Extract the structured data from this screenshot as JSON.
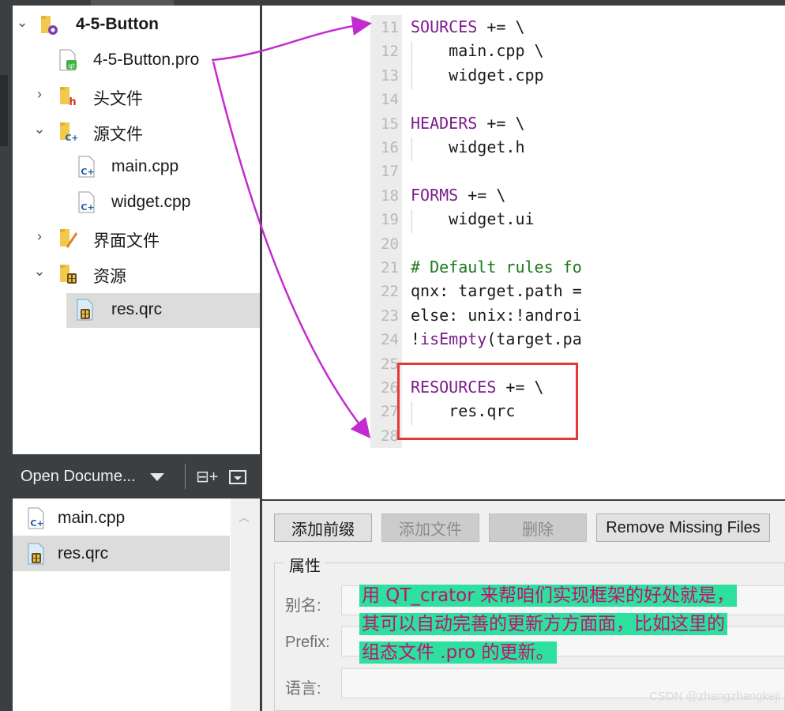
{
  "project_tree": {
    "root": {
      "label": "4-5-Button",
      "expanded": true
    },
    "items": [
      {
        "label": "4-5-Button.pro",
        "icon": "qt-project-file-icon"
      },
      {
        "label": "头文件",
        "icon": "header-folder-icon",
        "expanded": false
      },
      {
        "label": "源文件",
        "icon": "source-folder-icon",
        "expanded": true
      },
      {
        "label": "main.cpp",
        "icon": "cpp-file-icon"
      },
      {
        "label": "widget.cpp",
        "icon": "cpp-file-icon"
      },
      {
        "label": "界面文件",
        "icon": "forms-folder-icon",
        "expanded": false
      },
      {
        "label": "资源",
        "icon": "resources-folder-icon",
        "expanded": true
      },
      {
        "label": "res.qrc",
        "icon": "qrc-file-icon",
        "selected": true
      }
    ]
  },
  "open_documents": {
    "title": "Open Docume...",
    "items": [
      {
        "label": "main.cpp",
        "icon": "cpp-file-icon"
      },
      {
        "label": "res.qrc",
        "icon": "qrc-file-icon",
        "selected": true
      }
    ]
  },
  "editor": {
    "lines": [
      {
        "num": "11",
        "kw": "SOURCES",
        "rest": " += \\"
      },
      {
        "num": "12",
        "text": "    main.cpp \\"
      },
      {
        "num": "13",
        "text": "    widget.cpp"
      },
      {
        "num": "14",
        "text": ""
      },
      {
        "num": "15",
        "kw": "HEADERS",
        "rest": " += \\"
      },
      {
        "num": "16",
        "text": "    widget.h"
      },
      {
        "num": "17",
        "text": ""
      },
      {
        "num": "18",
        "kw": "FORMS",
        "rest": " += \\"
      },
      {
        "num": "19",
        "text": "    widget.ui"
      },
      {
        "num": "20",
        "text": ""
      },
      {
        "num": "21",
        "comment": "# Default rules fo"
      },
      {
        "num": "22",
        "text": "qnx: target.path ="
      },
      {
        "num": "23",
        "text": "else: unix:!androi"
      },
      {
        "num": "24",
        "pre": "!",
        "kw": "isEmpty",
        "rest": "(target.pa"
      },
      {
        "num": "25",
        "text": ""
      },
      {
        "num": "26",
        "kw": "RESOURCES",
        "rest": " += \\"
      },
      {
        "num": "27",
        "text": "    res.qrc"
      },
      {
        "num": "28",
        "text": ""
      }
    ]
  },
  "resource_editor": {
    "buttons": {
      "add_prefix": "添加前缀",
      "add_files": "添加文件",
      "delete": "删除",
      "remove_missing": "Remove Missing Files"
    },
    "properties_title": "属性",
    "fields": {
      "alias": "别名:",
      "prefix": "Prefix:",
      "language": "语言:"
    }
  },
  "annotation": {
    "lines": [
      "用 QT_crator 来帮咱们实现框架的好处就是，",
      "其可以自动完善的更新方方面面，比如这里的",
      "组态文件 .pro 的更新。"
    ]
  },
  "watermark": "CSDN @zhangzhangkeji",
  "colors": {
    "keyword": "#7a1d8a",
    "comment": "#1a7a1a",
    "annotation_text": "#c0126c",
    "annotation_highlight": "#2de0a0",
    "arrow": "#c32bd1",
    "red_box": "#e53935"
  }
}
